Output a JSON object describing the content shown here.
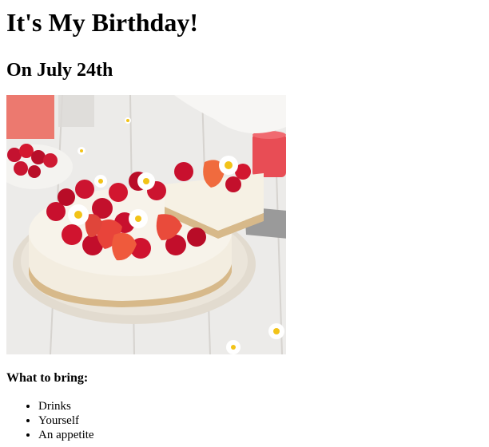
{
  "page": {
    "title": "It's My Birthday!",
    "subtitle": "On July 24th",
    "image_description": "cheesecake-with-strawberries-and-raspberries",
    "bring_heading": "What to bring:",
    "bring_items": [
      "Drinks",
      "Yourself",
      "An appetite"
    ]
  },
  "colors": {
    "text": "#000000",
    "background": "#ffffff",
    "berry_red": "#c8102e",
    "cream": "#f1ead6"
  }
}
